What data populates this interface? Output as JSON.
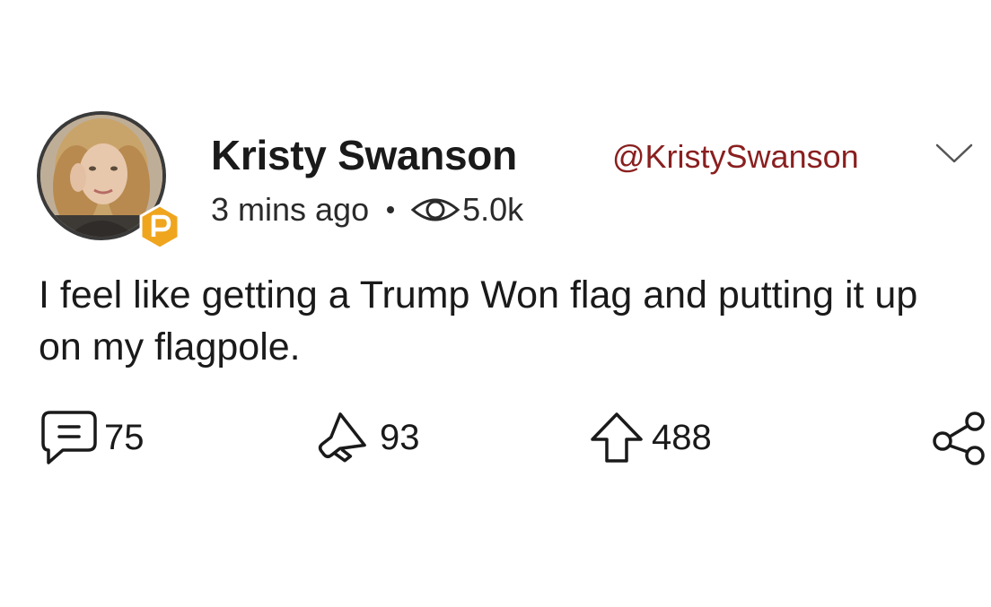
{
  "post": {
    "author_name": "Kristy Swanson",
    "author_handle": "@KristySwanson",
    "time_ago": "3 mins ago",
    "views": "5.0k",
    "text": "I feel like getting a Trump Won flag and putting it up on my flagpole.",
    "badge_letter": "P"
  },
  "actions": {
    "comments": "75",
    "echoes": "93",
    "upvotes": "488"
  },
  "colors": {
    "handle": "#8a1f1f",
    "badge": "#f0a51e",
    "text": "#1a1a1a"
  },
  "icons": {
    "menu": "chevron-down-icon",
    "views": "eye-icon",
    "comment": "comment-icon",
    "echo": "megaphone-icon",
    "upvote": "upvote-arrow-icon",
    "share": "share-icon"
  }
}
